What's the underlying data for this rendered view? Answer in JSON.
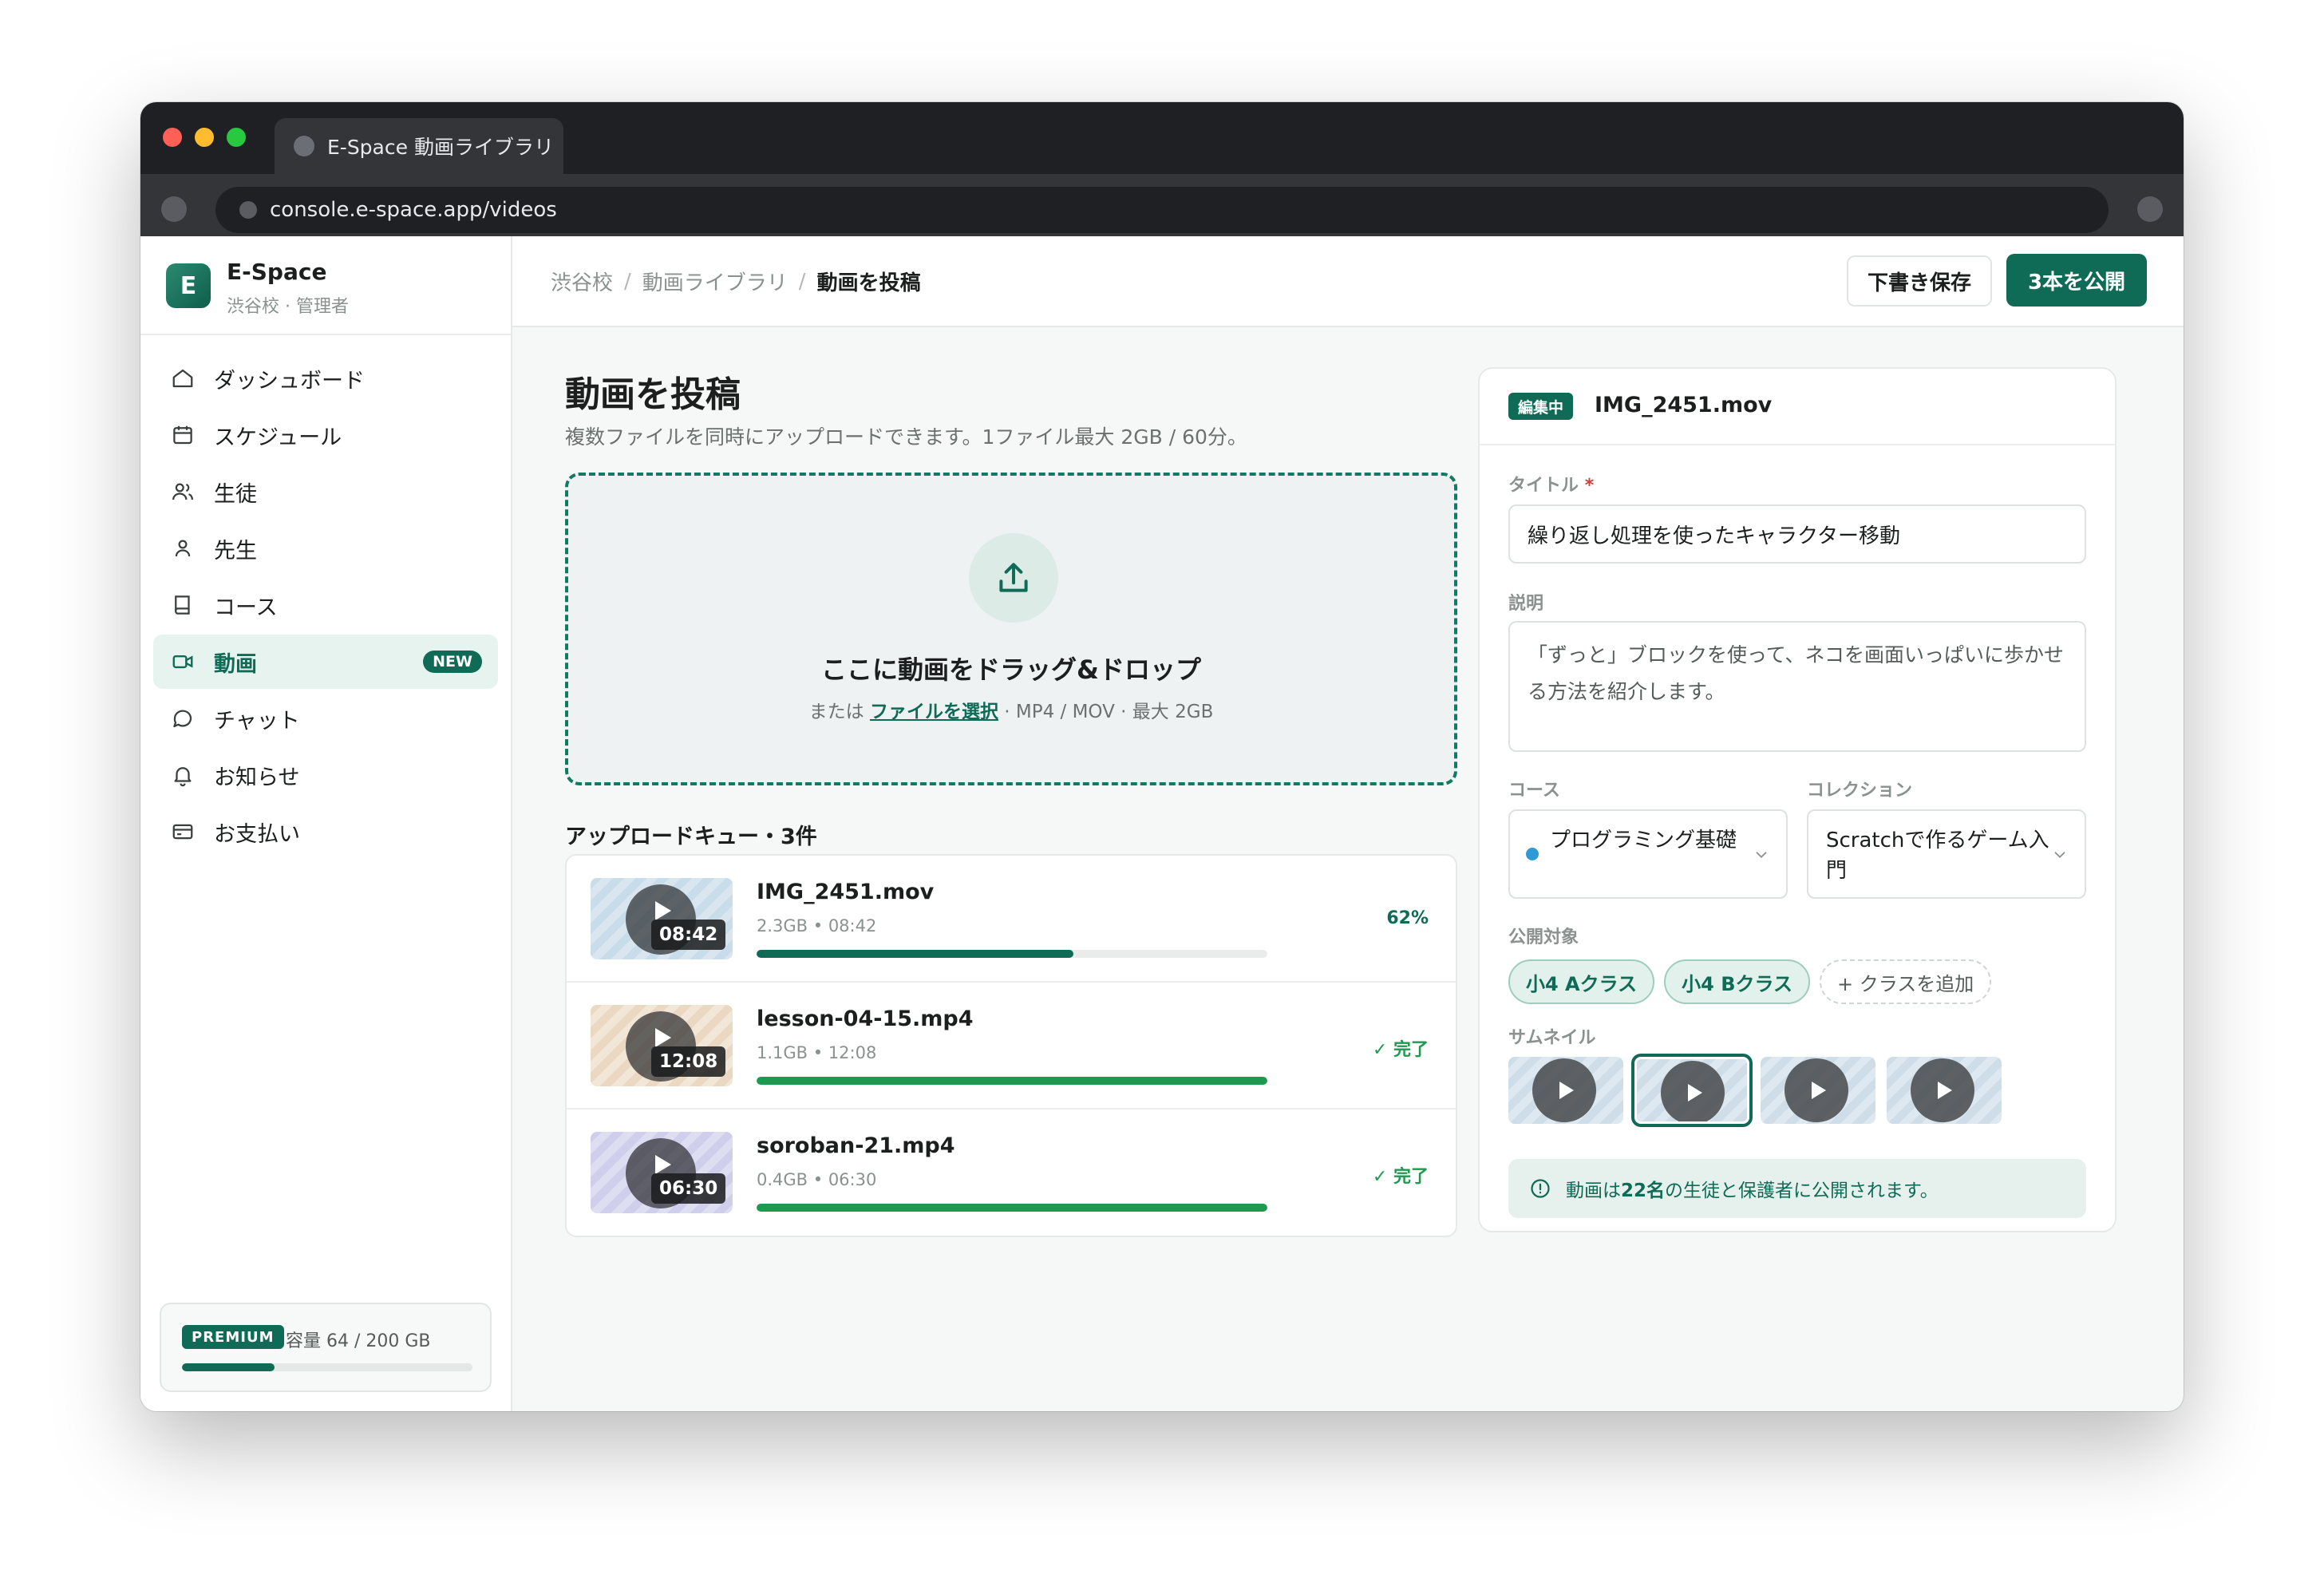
{
  "browser": {
    "tab_title": "E-Space 動画ライブラリ",
    "url": "console.e-space.app/videos"
  },
  "brand": {
    "name": "E-Space",
    "logo_letter": "E",
    "subtitle": "渋谷校 · 管理者"
  },
  "sidebar": {
    "items": [
      {
        "label": "ダッシュボード",
        "icon": "home-icon"
      },
      {
        "label": "スケジュール",
        "icon": "calendar-icon"
      },
      {
        "label": "生徒",
        "icon": "users-icon"
      },
      {
        "label": "先生",
        "icon": "user-icon"
      },
      {
        "label": "コース",
        "icon": "book-icon"
      },
      {
        "label": "動画",
        "icon": "video-icon",
        "active": true,
        "badge": "NEW"
      },
      {
        "label": "チャット",
        "icon": "chat-icon"
      },
      {
        "label": "お知らせ",
        "icon": "bell-icon"
      },
      {
        "label": "お支払い",
        "icon": "payment-icon"
      }
    ],
    "plan": {
      "badge": "PREMIUM",
      "usage_text": "容量 64 / 200 GB",
      "used_gb": 64,
      "total_gb": 200
    }
  },
  "header": {
    "breadcrumb": [
      "渋谷校",
      "動画ライブラリ",
      "動画を投稿"
    ],
    "separator": "/",
    "draft_label": "下書き保存",
    "publish_label": "3本を公開"
  },
  "main": {
    "title": "動画を投稿",
    "subtitle": "複数ファイルを同時にアップロードできます。1ファイル最大 2GB / 60分。",
    "dropzone": {
      "title": "ここに動画をドラッグ&ドロップ",
      "hint_prefix": "または",
      "hint_link": "ファイルを選択",
      "hint_suffix": "· MP4 / MOV · 最大 2GB"
    },
    "queue": {
      "title": "アップロードキュー・3件",
      "items": [
        {
          "name": "IMG_2451.mov",
          "meta": "2.3GB • 08:42",
          "duration": "08:42",
          "progress": 0.62,
          "status": "62%",
          "state": "uploading",
          "bar_color": "#0f6b56"
        },
        {
          "name": "lesson-04-15.mp4",
          "meta": "1.1GB • 12:08",
          "duration": "12:08",
          "progress": 1.0,
          "status": "✓ 完了",
          "state": "done",
          "bar_color": "#1d9a4f"
        },
        {
          "name": "soroban-21.mp4",
          "meta": "0.4GB • 06:30",
          "duration": "06:30",
          "progress": 1.0,
          "status": "✓ 完了",
          "state": "done",
          "bar_color": "#1d9a4f"
        }
      ]
    }
  },
  "editor": {
    "badge": "編集中",
    "file": "IMG_2451.mov",
    "title_label": "タイトル",
    "required_mark": "*",
    "title_value": "繰り返し処理を使ったキャラクター移動",
    "desc_label": "説明",
    "desc_value": "「ずっと」ブロックを使って、ネコを画面いっぱいに歩かせる方法を紹介します。",
    "course_label": "コース",
    "course_value": "プログラミング基礎",
    "collection_label": "コレクション",
    "collection_value": "Scratchで作るゲーム入門",
    "audience_label": "公開対象",
    "audience_chips": [
      "小4 Aクラス",
      "小4 Bクラス"
    ],
    "add_class_label": "+ クラスを追加",
    "thumbnail_label": "サムネイル",
    "thumbnail_count": 4,
    "selected_thumbnail": 2,
    "notice_prefix": "動画は",
    "notice_count": "22名",
    "notice_suffix": "の生徒と保護者に公開されます。"
  },
  "colors": {
    "accent": "#0f6b56",
    "success": "#1d9a4f",
    "course_dot": "#2f9bd6"
  }
}
